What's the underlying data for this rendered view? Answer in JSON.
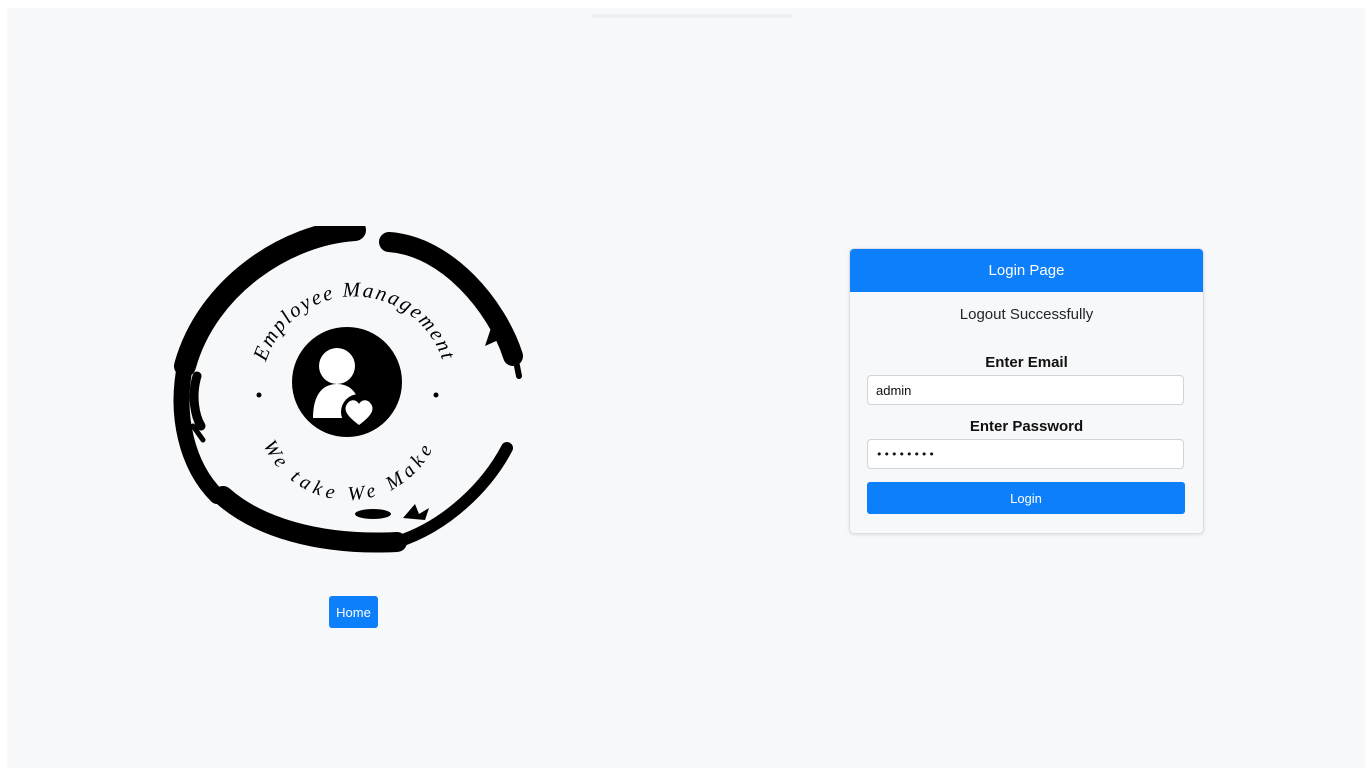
{
  "logo": {
    "top_text": "Employee Management",
    "bottom_text": "We take We Make",
    "icon": "employee-heart-icon"
  },
  "home_button": {
    "label": "Home"
  },
  "login_card": {
    "header": "Login Page",
    "status_message": "Logout Successfully",
    "email_label": "Enter Email",
    "email_value": "admin",
    "password_label": "Enter Password",
    "password_value": "••••••••",
    "submit_label": "Login"
  },
  "colors": {
    "accent": "#0d7ffb",
    "page_background": "#f7f8fa"
  }
}
